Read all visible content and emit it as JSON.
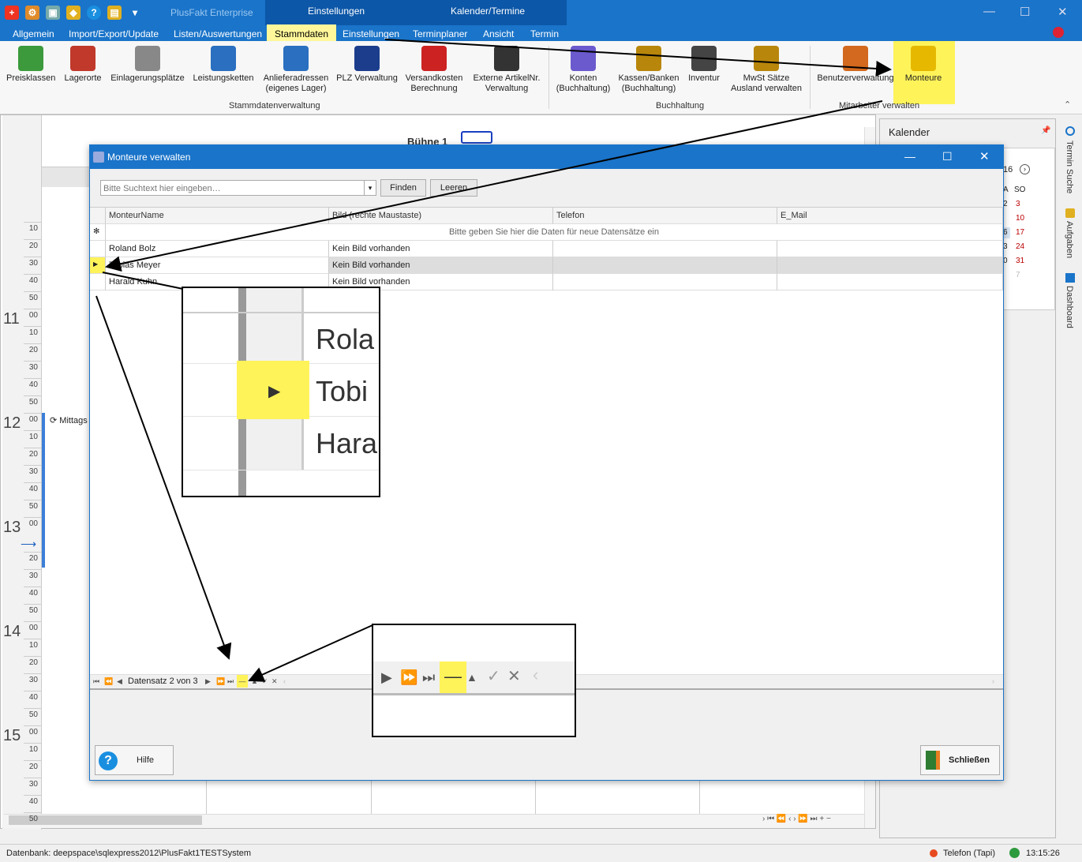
{
  "app": {
    "title": "PlusFakt Enterprise",
    "context_tabs": [
      "Einstellungen",
      "Kalender/Termine"
    ]
  },
  "ribbon_tabs": [
    "Allgemein",
    "Import/Export/Update",
    "Listen/Auswertungen",
    "Stammdaten",
    "Einstellungen",
    "Terminplaner",
    "Ansicht",
    "Termin"
  ],
  "ribbon_buttons": [
    {
      "label": "Preisklassen",
      "icon": "price-icon",
      "color": "#3c9a3c"
    },
    {
      "label": "Lagerorte",
      "icon": "warehouse-icon",
      "color": "#c0392b"
    },
    {
      "label": "Einlagerungsplätze",
      "icon": "storage-rack-icon",
      "color": "#888888"
    },
    {
      "label": "Leistungsketten",
      "icon": "chain-icon",
      "color": "#2a6fc0"
    },
    {
      "label": "Anlieferadressen\n(eigenes Lager)",
      "icon": "delivery-address-icon",
      "color": "#2a6fc0"
    },
    {
      "label": "PLZ Verwaltung",
      "icon": "plz-icon",
      "color": "#1b3d8c"
    },
    {
      "label": "Versandkosten\nBerechnung",
      "icon": "truck-icon",
      "color": "#cc2222"
    },
    {
      "label": "Externe ArtikelNr.\nVerwaltung",
      "icon": "barcode-icon",
      "color": "#333333"
    },
    {
      "label": "Konten\n(Buchhaltung)",
      "icon": "bank-icon",
      "color": "#6a5acd"
    },
    {
      "label": "Kassen/Banken\n(Buchhaltung)",
      "icon": "money-bag-icon",
      "color": "#b8860b"
    },
    {
      "label": "Inventur",
      "icon": "forklift-icon",
      "color": "#444444"
    },
    {
      "label": "MwSt Sätze\nAusland verwalten",
      "icon": "tax-bag-icon",
      "color": "#b8860b"
    },
    {
      "label": "Benutzerverwaltung",
      "icon": "user-admin-icon",
      "color": "#d2691e"
    },
    {
      "label": "Monteure",
      "icon": "worker-icon",
      "color": "#e6b800"
    }
  ],
  "ribbon_groups": [
    "Stammdatenverwaltung",
    "Buchhaltung",
    "Mitarbeiter verwalten"
  ],
  "calendar": {
    "resource": "Bühne 1",
    "appointment": "Mittags",
    "hours": [
      "11",
      "12",
      "13",
      "14",
      "15"
    ],
    "minutes": [
      "00",
      "10",
      "20",
      "30",
      "40",
      "50"
    ]
  },
  "kalender": {
    "title": "Kalender",
    "fragment_year": "16",
    "weekday_cols": [
      "A",
      "SO"
    ],
    "rows": [
      [
        "2",
        "3"
      ],
      [
        "",
        "10"
      ],
      [
        "6",
        "17"
      ],
      [
        "3",
        "24"
      ],
      [
        "0",
        "31"
      ],
      [
        "",
        "7"
      ]
    ]
  },
  "sidebar": [
    "Termin Suche",
    "Aufgaben",
    "Dashboard"
  ],
  "dialog": {
    "title": "Monteure verwalten",
    "search_placeholder": "Bitte Suchtext hier eingeben…",
    "find_label": "Finden",
    "clear_label": "Leeren",
    "columns": [
      "MonteurName",
      "Bild (rechte Maustaste)",
      "Telefon",
      "E_Mail"
    ],
    "new_row_hint": "Bitte geben Sie hier die Daten  für neue Datensätze ein",
    "rows": [
      {
        "name": "Roland Bolz",
        "bild": "Kein Bild vorhanden",
        "telefon": "",
        "email": ""
      },
      {
        "name": "Tobias Meyer",
        "bild": "Kein Bild vorhanden",
        "telefon": "",
        "email": ""
      },
      {
        "name": "Harald Kuhn",
        "bild": "Kein Bild vorhanden",
        "telefon": "",
        "email": ""
      }
    ],
    "nav_text": "Datensatz 2 von 3",
    "help_label": "Hilfe",
    "close_label": "Schließen"
  },
  "zoom1_rows": [
    "Rola",
    "Tobi",
    "Hara"
  ],
  "status": {
    "db": "Datenbank: deepspace\\sqlexpress2012\\PlusFakt1TESTSystem",
    "phone": "Telefon (Tapi)",
    "time": "13:15:26"
  }
}
